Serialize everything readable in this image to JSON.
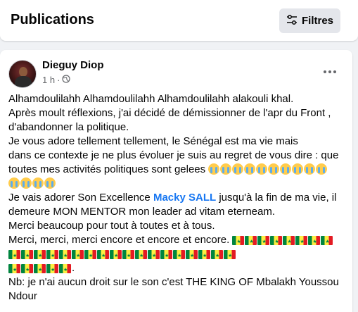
{
  "header": {
    "title": "Publications",
    "filter_label": "Filtres",
    "filter_icon": "sliders-icon"
  },
  "post": {
    "author": "Dieguy Diop",
    "time": "1 h",
    "separator": "·",
    "privacy_icon": "globe-icon",
    "more_icon": "more-horizontal-icon",
    "lines": {
      "l1": "Alhamdoulilahh Alhamdoulilahh Alhamdoulilahh alakouli khal.",
      "l2": "Après moult réflexions,  j'ai décidé de démissionner de l'apr du Front ,",
      "l3": "d'abandonner la politique.",
      "l4": "Je vous adore tellement tellement, le Sénégal est ma vie mais",
      "l5": "dans ce contexte je ne plus évoluer je suis au regret de vous dire : que",
      "l6": "toutes mes activités politiques sont gelees",
      "l7_a": "Je vais adorer Son Excellence ",
      "mention": "Macky SALL",
      "l7_b": "  jusqu'à la fin de ma vie,  il",
      "l8": "demeure MON MENTOR mon leader ad vitam eterneam.",
      "l9": "Merci beaucoup pour tout à toutes et à tous.",
      "l10": "Merci,  merci,  merci encore et encore et encore.",
      "l10_end": ".",
      "l11": "Nb: je n'ai aucun droit sur le son c'est THE KING OF Mbalakh Youssou",
      "l12": "Ndour"
    },
    "emoji": {
      "crying": "crying-face-emoji",
      "flag": "senegal-flag-emoji"
    }
  }
}
